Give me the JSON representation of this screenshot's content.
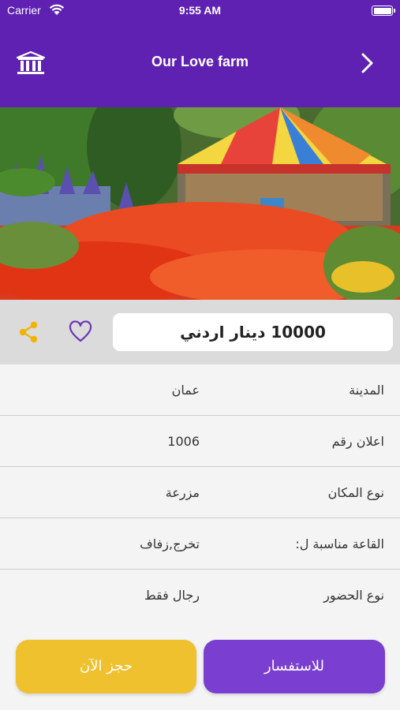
{
  "status_bar": {
    "carrier": "Carrier",
    "time": "9:55 AM"
  },
  "nav": {
    "title": "Our Love farm",
    "left_icon": "building-icon",
    "right_icon": "chevron-right-icon"
  },
  "price": {
    "text": "10000 دينار اردني"
  },
  "details": [
    {
      "label": "المدينة",
      "value": "عمان"
    },
    {
      "label": "اعلان رقم",
      "value": "1006"
    },
    {
      "label": "نوع المكان",
      "value": "مزرعة"
    },
    {
      "label": "القاعة مناسبة ل:",
      "value": "تخرج,زفاف"
    },
    {
      "label": "نوع الحضور",
      "value": "رجال فقط"
    }
  ],
  "buttons": {
    "book": "حجز الآن",
    "inquire": "للاستفسار"
  },
  "colors": {
    "header": "#5e21b1",
    "book": "#f0c12f",
    "inquire": "#7a3fd1",
    "share": "#f0b400",
    "heart": "#6a35b8"
  }
}
